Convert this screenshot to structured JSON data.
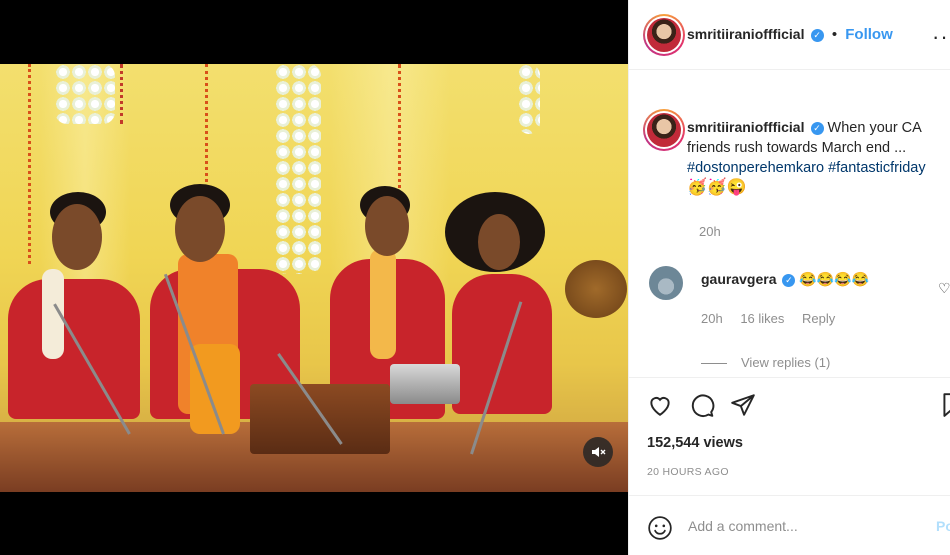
{
  "post": {
    "username": "smritiiranioffficial",
    "follow_label": "Follow",
    "separator": "•",
    "more_glyph": "···",
    "caption": {
      "text": "When your CA friends rush towards March end ...",
      "hashtags": "#dostonperehemkaro #fantasticfriday",
      "emojis": "🥳🥳😜",
      "time": "20h"
    },
    "views": "152,544 views",
    "posted": "20 HOURS AGO"
  },
  "comments": [
    {
      "username": "gauravgera",
      "text": "😂😂😂😂",
      "time": "20h",
      "likes": "16 likes",
      "reply_label": "Reply",
      "view_replies": "View replies (1)"
    }
  ],
  "composer": {
    "placeholder": "Add a comment...",
    "post_label": "Po"
  },
  "icons": {
    "like": "heart-icon",
    "comment": "comment-icon",
    "share": "paper-plane-icon",
    "save": "bookmark-icon",
    "mute": "speaker-muted-icon",
    "emoji": "smiley-icon",
    "verified": "verified-badge-icon"
  },
  "colors": {
    "accent": "#3897f0",
    "hashtag": "#00376b",
    "muted_text": "#8e8e8e"
  }
}
